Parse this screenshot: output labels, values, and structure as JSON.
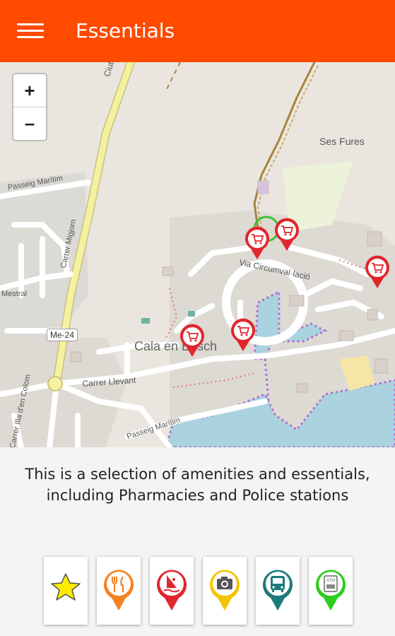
{
  "appbar": {
    "title": "Essentials",
    "menu_icon": "hamburger-menu-icon",
    "color": "#ff4a00"
  },
  "map": {
    "zoom_in": "+",
    "zoom_out": "–",
    "labels": {
      "ciutadella": "Ciutad",
      "ses_fures": "Ses Fures",
      "passeig_maritim_top": "Passeig Marítim",
      "carrer_migjorn": "Carrer Migjorn",
      "mestral": "Mestral",
      "me24": "Me-24",
      "via_circumval": "Via Circumval·lació",
      "cala_en_bosch": "Cala en Bosch",
      "carrer_llevant": "Carrer Llevant",
      "passeig_maritim_bottom": "Passeig Marítim",
      "illa": "Carrer Illa d'en Colom"
    },
    "marker_icon": "shopping-cart-icon"
  },
  "description": "This is a selection of amenities and essentials, including Pharmacies and Police stations",
  "categories": [
    {
      "icon": "star-icon",
      "color": "#ffeb00"
    },
    {
      "icon": "restaurant-icon",
      "color": "#f58220"
    },
    {
      "icon": "windsurf-icon",
      "color": "#e1262d"
    },
    {
      "icon": "camera-icon",
      "color": "#f5c400"
    },
    {
      "icon": "bus-icon",
      "color": "#1d7a7a"
    },
    {
      "icon": "atm-icon",
      "color": "#2ecc1e"
    }
  ]
}
